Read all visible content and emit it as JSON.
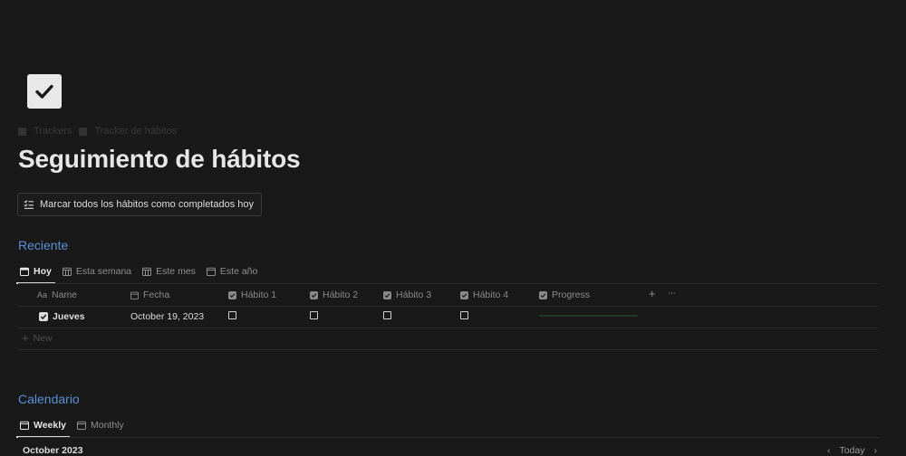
{
  "page": {
    "icon": "check-icon",
    "breadcrumbs": [
      "Trackers",
      "Tracker de hábitos"
    ],
    "title": "Seguimiento de hábitos",
    "action_button": "Marcar todos los hábitos como completados hoy"
  },
  "recent": {
    "heading": "Reciente",
    "tabs": [
      {
        "label": "Hoy",
        "icon": "calendar-icon",
        "active": true
      },
      {
        "label": "Esta semana",
        "icon": "calendar-icon",
        "active": false
      },
      {
        "label": "Este mes",
        "icon": "calendar-icon",
        "active": false
      },
      {
        "label": "Este año",
        "icon": "calendar-icon",
        "active": false
      }
    ],
    "columns": [
      {
        "label": "Name",
        "prefix": "Aa"
      },
      {
        "label": "Fecha"
      },
      {
        "label": "Hábito 1"
      },
      {
        "label": "Hábito 2"
      },
      {
        "label": "Hábito 3"
      },
      {
        "label": "Hábito 4"
      },
      {
        "label": "Progress"
      }
    ],
    "rows": [
      {
        "name": "Jueves",
        "fecha": "October 19, 2023",
        "habits": [
          false,
          false,
          false,
          false
        ],
        "progress": 0
      }
    ],
    "add_column": "+",
    "more": "···",
    "new_label": "New"
  },
  "calendar": {
    "heading": "Calendario",
    "tabs": [
      {
        "label": "Weekly",
        "icon": "calendar-icon",
        "active": true
      },
      {
        "label": "Monthly",
        "icon": "calendar-icon",
        "active": false
      }
    ],
    "month_label": "October 2023",
    "today_label": "Today"
  },
  "colors": {
    "background": "#191919",
    "heading_accent": "#5b8fd6",
    "progress_fill": "#3d8b5a"
  }
}
